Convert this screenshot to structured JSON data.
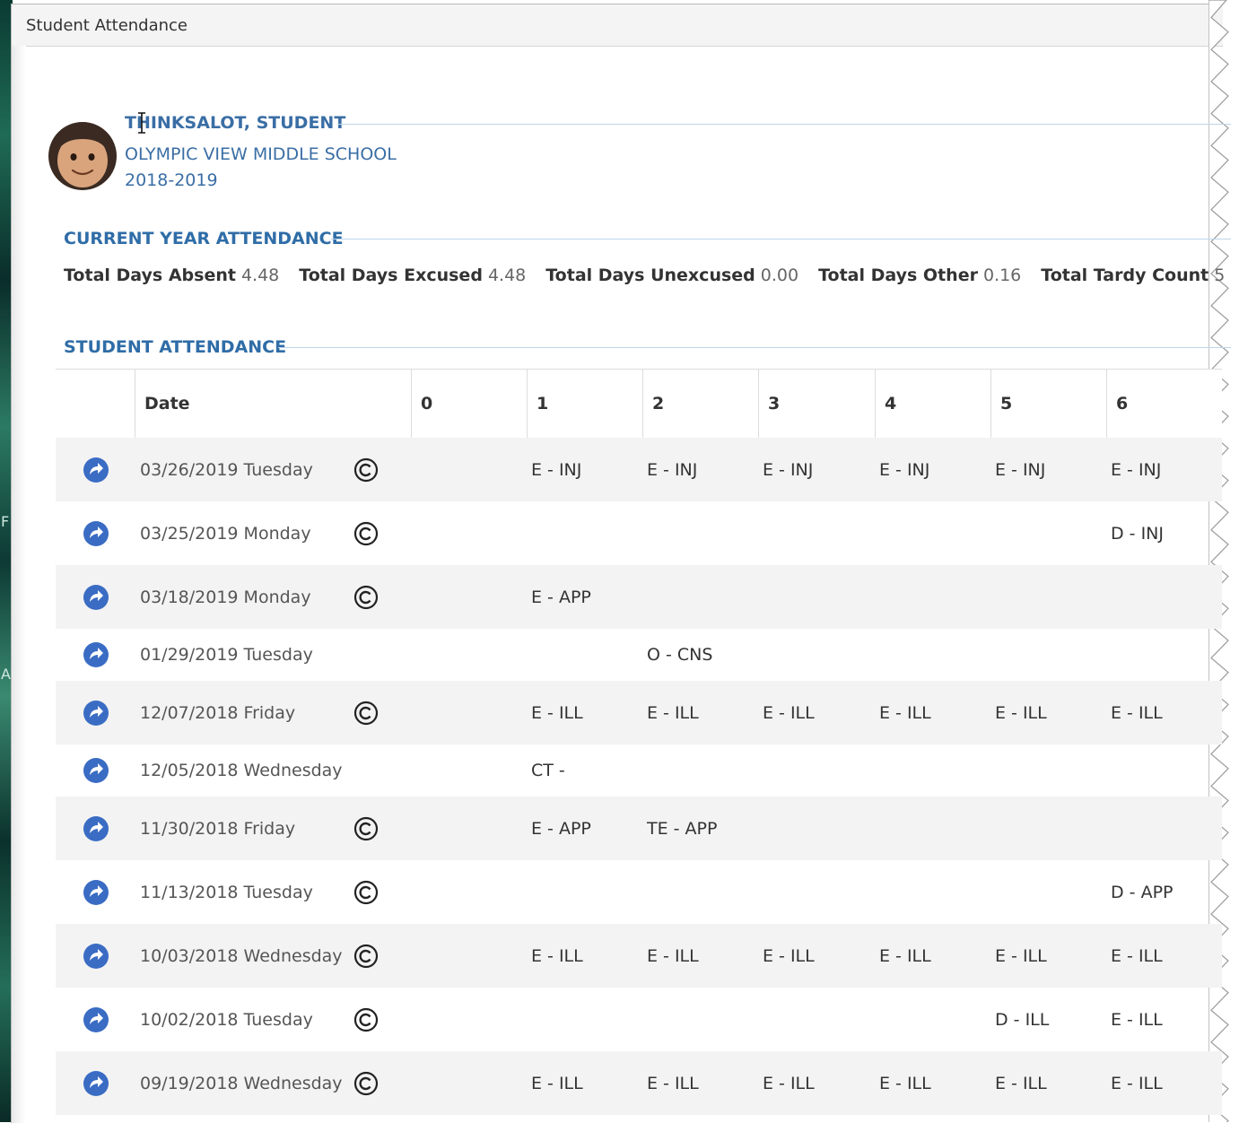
{
  "window": {
    "title": "Student Attendance"
  },
  "desktop_edge": {
    "letters": [
      "F",
      "A"
    ]
  },
  "student": {
    "name": "THINKSALOT, STUDENT",
    "school": "OLYMPIC VIEW MIDDLE SCHOOL",
    "year": "2018-2019"
  },
  "current_year": {
    "heading": "CURRENT YEAR ATTENDANCE",
    "totals": [
      {
        "label": "Total Days Absent",
        "value": "4.48"
      },
      {
        "label": "Total Days Excused",
        "value": "4.48"
      },
      {
        "label": "Total Days Unexcused",
        "value": "0.00"
      },
      {
        "label": "Total Days Other",
        "value": "0.16"
      },
      {
        "label": "Total Tardy Count",
        "value": "5"
      }
    ]
  },
  "attendance": {
    "heading": "STUDENT ATTENDANCE",
    "columns": [
      "Date",
      "0",
      "1",
      "2",
      "3",
      "4",
      "5",
      "6"
    ],
    "rows": [
      {
        "date": "03/26/2019 Tuesday",
        "comment": true,
        "periods": [
          "",
          "E - INJ",
          "E - INJ",
          "E - INJ",
          "E - INJ",
          "E - INJ",
          "E - INJ"
        ]
      },
      {
        "date": "03/25/2019 Monday",
        "comment": true,
        "periods": [
          "",
          "",
          "",
          "",
          "",
          "",
          "D - INJ"
        ]
      },
      {
        "date": "03/18/2019 Monday",
        "comment": true,
        "periods": [
          "",
          "E - APP",
          "",
          "",
          "",
          "",
          ""
        ]
      },
      {
        "date": "01/29/2019 Tuesday",
        "comment": false,
        "periods": [
          "",
          "",
          "O - CNS",
          "",
          "",
          "",
          ""
        ]
      },
      {
        "date": "12/07/2018 Friday",
        "comment": true,
        "periods": [
          "",
          "E - ILL",
          "E - ILL",
          "E - ILL",
          "E - ILL",
          "E - ILL",
          "E - ILL"
        ]
      },
      {
        "date": "12/05/2018 Wednesday",
        "comment": false,
        "periods": [
          "",
          "CT -",
          "",
          "",
          "",
          "",
          ""
        ]
      },
      {
        "date": "11/30/2018 Friday",
        "comment": true,
        "periods": [
          "",
          "E - APP",
          "TE - APP",
          "",
          "",
          "",
          ""
        ]
      },
      {
        "date": "11/13/2018 Tuesday",
        "comment": true,
        "periods": [
          "",
          "",
          "",
          "",
          "",
          "",
          "D - APP"
        ]
      },
      {
        "date": "10/03/2018 Wednesday",
        "comment": true,
        "periods": [
          "",
          "E - ILL",
          "E - ILL",
          "E - ILL",
          "E - ILL",
          "E - ILL",
          "E - ILL"
        ]
      },
      {
        "date": "10/02/2018 Tuesday",
        "comment": true,
        "periods": [
          "",
          "",
          "",
          "",
          "",
          "D - ILL",
          "E - ILL"
        ]
      },
      {
        "date": "09/19/2018 Wednesday",
        "comment": true,
        "periods": [
          "",
          "E - ILL",
          "E - ILL",
          "E - ILL",
          "E - ILL",
          "E - ILL",
          "E - ILL"
        ]
      }
    ]
  },
  "colors": {
    "accent": "#2f6da7",
    "icon": "#3a6cc4",
    "row_shade": "#f3f3f3"
  }
}
